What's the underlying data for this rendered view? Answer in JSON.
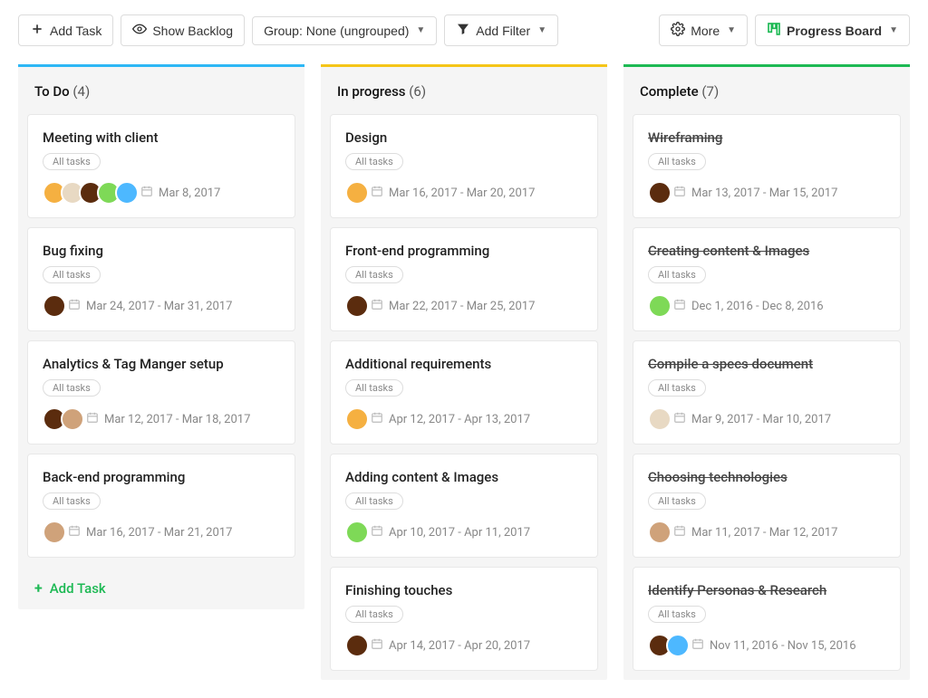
{
  "toolbar": {
    "add_task": "Add Task",
    "show_backlog": "Show Backlog",
    "group": "Group: None (ungrouped)",
    "add_filter": "Add Filter",
    "more": "More",
    "progress_board": "Progress Board"
  },
  "columns": [
    {
      "title": "To Do",
      "count": "(4)",
      "bar": "#2db7f5",
      "add_task_label": "Add Task",
      "cards": [
        {
          "title": "Meeting with client",
          "tag": "All tasks",
          "date": "Mar 8, 2017",
          "avatars": [
            "#f5b041",
            "#e8d9c3",
            "#5b2c0e",
            "#7ed957",
            "#4db8ff"
          ],
          "done": false
        },
        {
          "title": "Bug fixing",
          "tag": "All tasks",
          "date": "Mar 24, 2017 - Mar 31, 2017",
          "avatars": [
            "#5b2c0e"
          ],
          "done": false
        },
        {
          "title": "Analytics & Tag Manger setup",
          "tag": "All tasks",
          "date": "Mar 12, 2017 - Mar 18, 2017",
          "avatars": [
            "#5b2c0e",
            "#cfa27a"
          ],
          "done": false
        },
        {
          "title": "Back-end programming",
          "tag": "All tasks",
          "date": "Mar 16, 2017 - Mar 21, 2017",
          "avatars": [
            "#cfa27a"
          ],
          "done": false
        }
      ]
    },
    {
      "title": "In progress",
      "count": "(6)",
      "bar": "#f5c518",
      "cards": [
        {
          "title": "Design",
          "tag": "All tasks",
          "date": "Mar 16, 2017 - Mar 20, 2017",
          "avatars": [
            "#f5b041"
          ],
          "done": false
        },
        {
          "title": "Front-end programming",
          "tag": "All tasks",
          "date": "Mar 22, 2017 - Mar 25, 2017",
          "avatars": [
            "#5b2c0e"
          ],
          "done": false
        },
        {
          "title": "Additional requirements",
          "tag": "All tasks",
          "date": "Apr 12, 2017 - Apr 13, 2017",
          "avatars": [
            "#f5b041"
          ],
          "done": false
        },
        {
          "title": "Adding content & Images",
          "tag": "All tasks",
          "date": "Apr 10, 2017 - Apr 11, 2017",
          "avatars": [
            "#7ed957"
          ],
          "done": false
        },
        {
          "title": "Finishing touches",
          "tag": "All tasks",
          "date": "Apr 14, 2017 - Apr 20, 2017",
          "avatars": [
            "#5b2c0e"
          ],
          "done": false
        }
      ]
    },
    {
      "title": "Complete",
      "count": "(7)",
      "bar": "#1db954",
      "cards": [
        {
          "title": "Wireframing",
          "tag": "All tasks",
          "date": "Mar 13, 2017 - Mar 15, 2017",
          "avatars": [
            "#5b2c0e"
          ],
          "done": true
        },
        {
          "title": "Creating content & Images",
          "tag": "All tasks",
          "date": "Dec 1, 2016 - Dec 8, 2016",
          "avatars": [
            "#7ed957"
          ],
          "done": true
        },
        {
          "title": "Compile a specs document",
          "tag": "All tasks",
          "date": "Mar 9, 2017 - Mar 10, 2017",
          "avatars": [
            "#e8d9c3"
          ],
          "done": true
        },
        {
          "title": "Choosing technologies",
          "tag": "All tasks",
          "date": "Mar 11, 2017 - Mar 12, 2017",
          "avatars": [
            "#cfa27a"
          ],
          "done": true
        },
        {
          "title": "Identify Personas & Research",
          "tag": "All tasks",
          "date": "Nov 11, 2016 - Nov 15, 2016",
          "avatars": [
            "#5b2c0e",
            "#4db8ff"
          ],
          "done": true
        }
      ]
    }
  ]
}
